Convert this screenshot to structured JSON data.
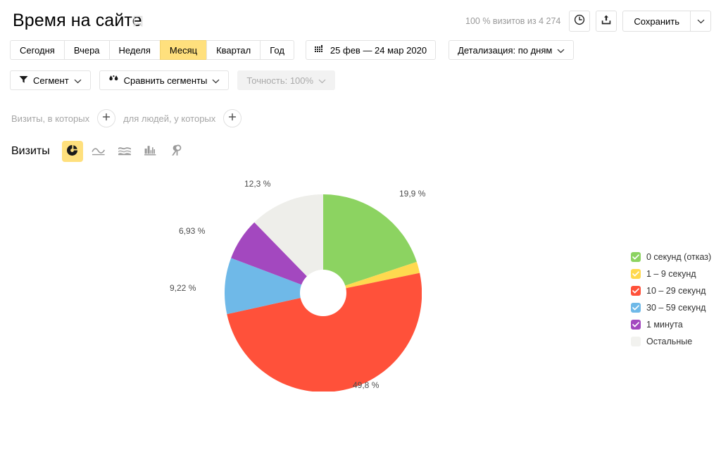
{
  "header": {
    "title": "Время на сайте",
    "bookmark_icon": "bookmark-icon",
    "visits_note": "100 % визитов из 4 274",
    "clock_icon": "clock-icon",
    "share_icon": "share-icon",
    "save_label": "Сохранить",
    "save_caret_icon": "chevron-down-icon"
  },
  "period_tabs": [
    {
      "label": "Сегодня",
      "active": false
    },
    {
      "label": "Вчера",
      "active": false
    },
    {
      "label": "Неделя",
      "active": false
    },
    {
      "label": "Месяц",
      "active": true
    },
    {
      "label": "Квартал",
      "active": false
    },
    {
      "label": "Год",
      "active": false
    }
  ],
  "date_range": {
    "icon": "calendar-icon",
    "label": "25 фев — 24 мар 2020"
  },
  "detail": {
    "label": "Детализация: по дням",
    "caret_icon": "chevron-down-icon"
  },
  "segment_bar": {
    "segment": {
      "icon": "funnel-icon",
      "label": "Сегмент",
      "caret_icon": "chevron-down-icon"
    },
    "compare": {
      "icon": "droplets-icon",
      "label": "Сравнить сегменты",
      "caret_icon": "chevron-down-icon"
    },
    "accuracy": {
      "label": "Точность: 100%",
      "caret_icon": "chevron-down-icon",
      "disabled": true
    }
  },
  "filters": {
    "visits_label": "Визиты, в которых",
    "visits_add_icon": "plus-icon",
    "people_label": "для людей, у которых",
    "people_add_icon": "plus-icon"
  },
  "metric": {
    "label": "Визиты",
    "chart_types": [
      {
        "icon": "pie-chart-icon",
        "active": true
      },
      {
        "icon": "line-chart-icon",
        "active": false
      },
      {
        "icon": "area-chart-icon",
        "active": false
      },
      {
        "icon": "bar-chart-icon",
        "active": false
      },
      {
        "icon": "map-pin-icon",
        "active": false
      }
    ]
  },
  "colors": {
    "green": "#8cd361",
    "yellow": "#ffd94f",
    "red": "#ff513a",
    "blue": "#6fb9e8",
    "purple": "#a348bf",
    "gray": "#eeeeea",
    "accent": "#ffe07d"
  },
  "chart_data": {
    "type": "pie",
    "title": "Время на сайте",
    "donut": true,
    "legend_position": "right",
    "labels_suffix": " %",
    "categories": [
      "0 секунд (отказ)",
      "1 – 9 секунд",
      "10 – 29 секунд",
      "30 – 59 секунд",
      "1 минута",
      "Остальные"
    ],
    "values": [
      19.9,
      1.86,
      49.8,
      9.22,
      6.93,
      12.3
    ],
    "value_labels": [
      "19,9 %",
      "",
      "49,8 %",
      "9,22 %",
      "6,93 %",
      "12,3 %"
    ],
    "colors": [
      "#8cd361",
      "#ffd94f",
      "#ff513a",
      "#6fb9e8",
      "#a348bf",
      "#eeeeea"
    ],
    "enabled": [
      true,
      true,
      true,
      true,
      true,
      false
    ],
    "total_visits": "4 274"
  }
}
